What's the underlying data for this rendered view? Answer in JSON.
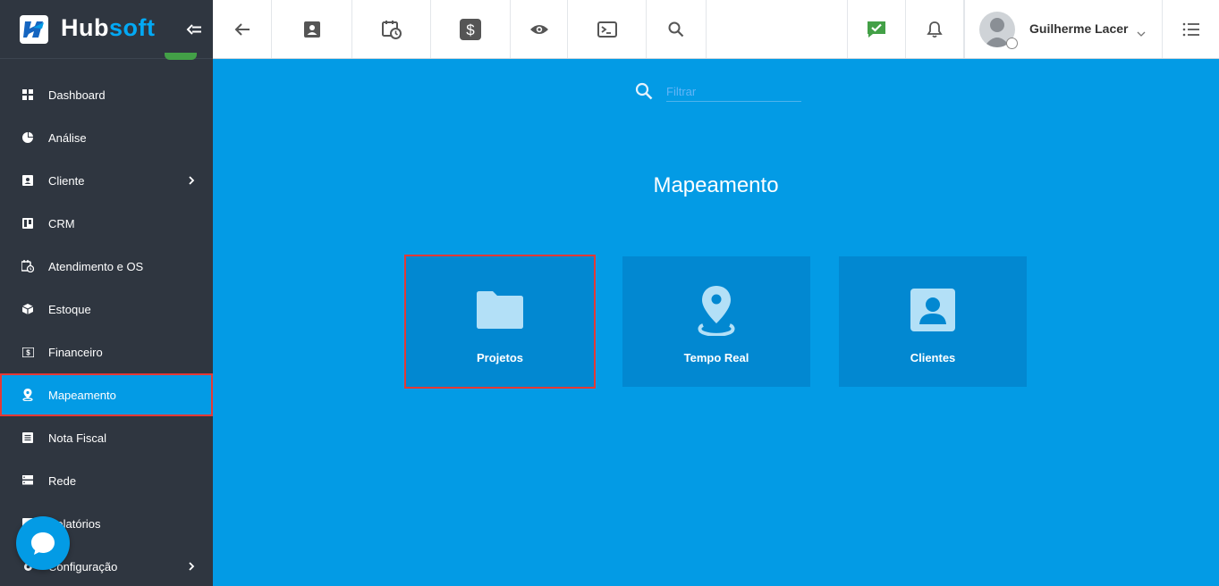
{
  "brand": {
    "hub": "Hub",
    "soft": "soft"
  },
  "sidebar": {
    "items": [
      {
        "label": "Dashboard",
        "icon": "dashboard-icon",
        "chevron": false
      },
      {
        "label": "Análise",
        "icon": "pie-chart-icon",
        "chevron": false
      },
      {
        "label": "Cliente",
        "icon": "contact-card-icon",
        "chevron": true
      },
      {
        "label": "CRM",
        "icon": "trello-board-icon",
        "chevron": false
      },
      {
        "label": "Atendimento e OS",
        "icon": "calendar-clock-icon",
        "chevron": false
      },
      {
        "label": "Estoque",
        "icon": "package-icon",
        "chevron": false
      },
      {
        "label": "Financeiro",
        "icon": "money-icon",
        "chevron": false
      },
      {
        "label": "Mapeamento",
        "icon": "map-pin-icon",
        "chevron": false,
        "active": true
      },
      {
        "label": "Nota Fiscal",
        "icon": "document-icon",
        "chevron": false
      },
      {
        "label": "Rede",
        "icon": "server-icon",
        "chevron": false
      },
      {
        "label": "Relatórios",
        "icon": "report-icon",
        "chevron": false
      },
      {
        "label": "Configuração",
        "icon": "gear-icon",
        "chevron": true
      }
    ]
  },
  "topbar": {
    "user_name": "Guilherme Lacer"
  },
  "filter": {
    "placeholder": "Filtrar"
  },
  "main": {
    "title": "Mapeamento",
    "tiles": [
      {
        "label": "Projetos",
        "icon": "folder-icon",
        "selected": true
      },
      {
        "label": "Tempo Real",
        "icon": "map-marker-icon",
        "selected": false
      },
      {
        "label": "Clientes",
        "icon": "contact-icon",
        "selected": false
      }
    ]
  },
  "colors": {
    "sidebar_bg": "#2f3640",
    "accent": "#039be5",
    "tile_bg": "#0288d1",
    "highlight": "#e53935"
  }
}
